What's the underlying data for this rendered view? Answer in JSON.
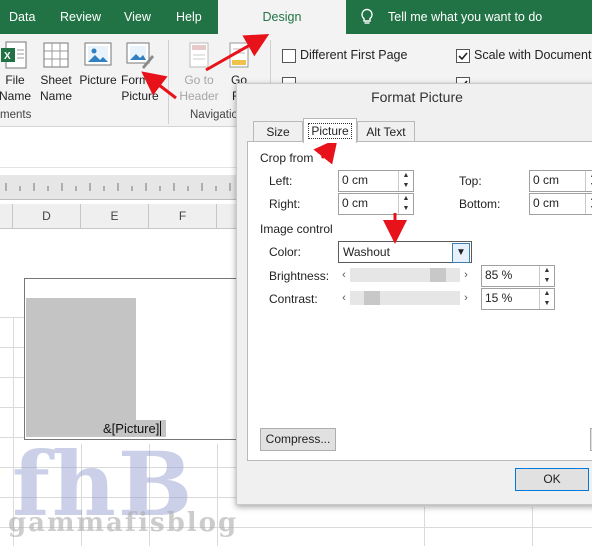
{
  "ribbon": {
    "tabs": [
      {
        "label": "Data"
      },
      {
        "label": "Review"
      },
      {
        "label": "View"
      },
      {
        "label": "Help"
      },
      {
        "label": "Design"
      }
    ],
    "tell_me": "Tell me what you want to do",
    "buttons": {
      "file_name": "File\nName",
      "sheet_name": "Sheet\nName",
      "picture": "Picture",
      "format_picture": "Format\nPicture",
      "go_to_header": "Go to\nHeader",
      "go_to_footer_partial": "Go\nFo"
    },
    "groups": {
      "elements_partial": "ments",
      "navigation_partial": "Navigatio"
    },
    "options": {
      "different_first_page": {
        "label": "Different First Page",
        "checked": false
      },
      "scale_with_document": {
        "label": "Scale with Document",
        "checked": true
      }
    }
  },
  "sheet": {
    "columns": [
      "D",
      "E",
      "F"
    ],
    "header_field": "&[Picture]"
  },
  "dialog": {
    "title": "Format Picture",
    "tabs": [
      "Size",
      "Picture",
      "Alt Text"
    ],
    "active_tab": "Picture",
    "crop_from": {
      "label": "Crop from",
      "left": {
        "label": "Left:",
        "value": "0 cm"
      },
      "right": {
        "label": "Right:",
        "value": "0 cm"
      },
      "top": {
        "label": "Top:",
        "value": "0 cm"
      },
      "bottom": {
        "label": "Bottom:",
        "value": "0 cm"
      }
    },
    "image_control": {
      "label": "Image control",
      "color": {
        "label": "Color:",
        "value": "Washout"
      },
      "brightness": {
        "label": "Brightness:",
        "value": "85 %",
        "level": 85
      },
      "contrast": {
        "label": "Contrast:",
        "value": "15 %",
        "level": 15
      }
    },
    "compress_label": "Compress...",
    "ok_label": "OK"
  },
  "watermark": {
    "big": "fhB",
    "small": "gammafisblog"
  },
  "colors": {
    "ribbon_green": "#217346",
    "ribbon_bg": "#f3f3f3",
    "arrow_red": "#e8121b",
    "washout_gray": "#c4c4c4"
  }
}
